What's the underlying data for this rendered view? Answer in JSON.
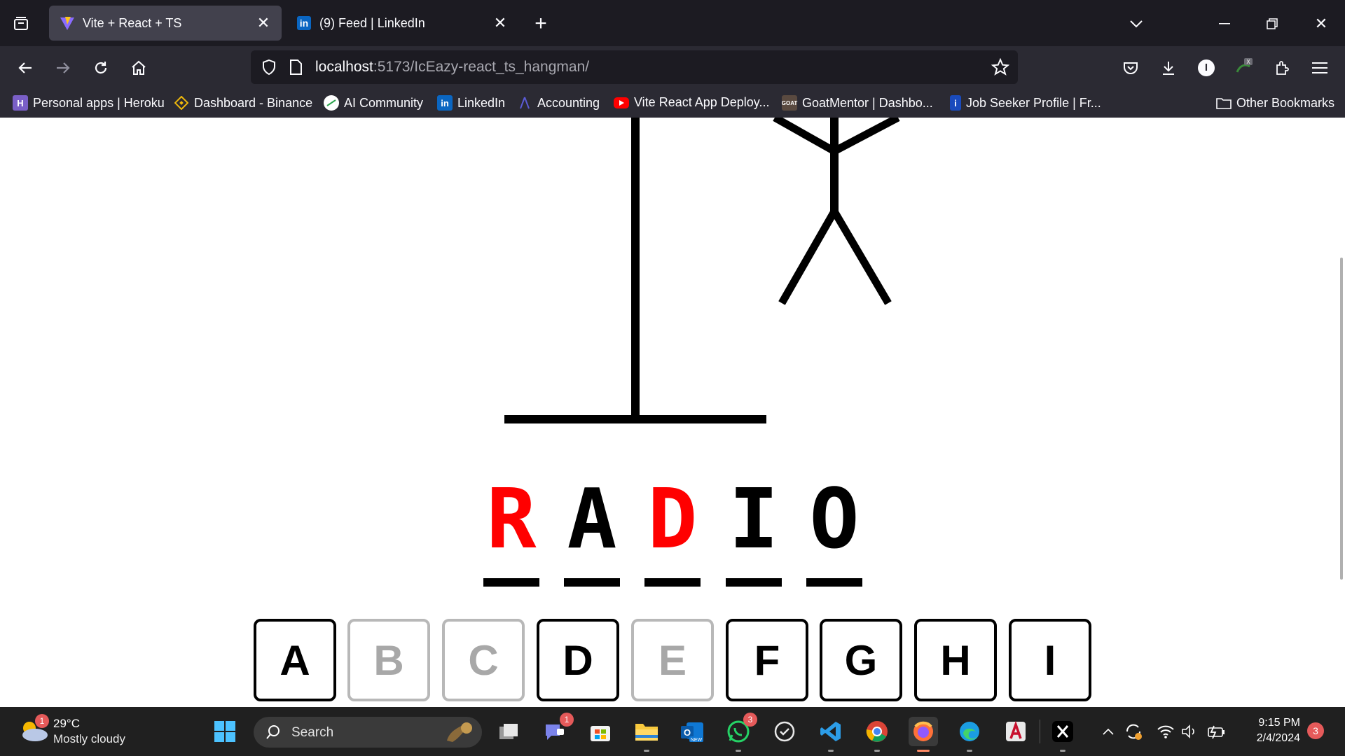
{
  "browser": {
    "tabs": [
      {
        "title": "Vite + React + TS",
        "active": true
      },
      {
        "title": "(9) Feed | LinkedIn",
        "active": false
      }
    ],
    "url_host": "localhost",
    "url_path": ":5173/IcEazy-react_ts_hangman/",
    "bookmarks": [
      {
        "label": "Personal apps | Heroku",
        "icon": "heroku-icon"
      },
      {
        "label": "Dashboard - Binance",
        "icon": "binance-icon"
      },
      {
        "label": "AI Community",
        "icon": "ai-community-icon"
      },
      {
        "label": "LinkedIn",
        "icon": "linkedin-icon"
      },
      {
        "label": "Accounting",
        "icon": "accounting-icon"
      },
      {
        "label": "Vite React App Deploy...",
        "icon": "youtube-icon"
      },
      {
        "label": "GoatMentor | Dashbo...",
        "icon": "goatmentor-icon"
      },
      {
        "label": "Job Seeker Profile | Fr...",
        "icon": "job-seeker-icon"
      }
    ],
    "other_bookmarks": "Other Bookmarks"
  },
  "game": {
    "word_letters": [
      {
        "char": "R",
        "status": "missed",
        "color": "#ff0000"
      },
      {
        "char": "A",
        "status": "guessed",
        "color": "#000000"
      },
      {
        "char": "D",
        "status": "missed",
        "color": "#ff0000"
      },
      {
        "char": "I",
        "status": "guessed",
        "color": "#000000"
      },
      {
        "char": "O",
        "status": "guessed",
        "color": "#000000"
      }
    ],
    "keys": [
      {
        "label": "A",
        "state": "active"
      },
      {
        "label": "B",
        "state": "inactive"
      },
      {
        "label": "C",
        "state": "inactive"
      },
      {
        "label": "D",
        "state": "active"
      },
      {
        "label": "E",
        "state": "inactive"
      },
      {
        "label": "F",
        "state": "active"
      },
      {
        "label": "G",
        "state": "active"
      },
      {
        "label": "H",
        "state": "active"
      },
      {
        "label": "I",
        "state": "active"
      }
    ]
  },
  "taskbar": {
    "weather_temp": "29°C",
    "weather_desc": "Mostly cloudy",
    "weather_badge": "1",
    "search_label": "Search",
    "teams_badge": "1",
    "whatsapp_badge": "3",
    "time": "9:15 PM",
    "date": "2/4/2024",
    "notification_count": "3"
  },
  "colors": {
    "tab_bar": "#1c1b22",
    "nav_bar": "#2b2a33",
    "active_tab": "#42414d",
    "missed_letter": "#ff0000",
    "taskbar": "#202020"
  }
}
